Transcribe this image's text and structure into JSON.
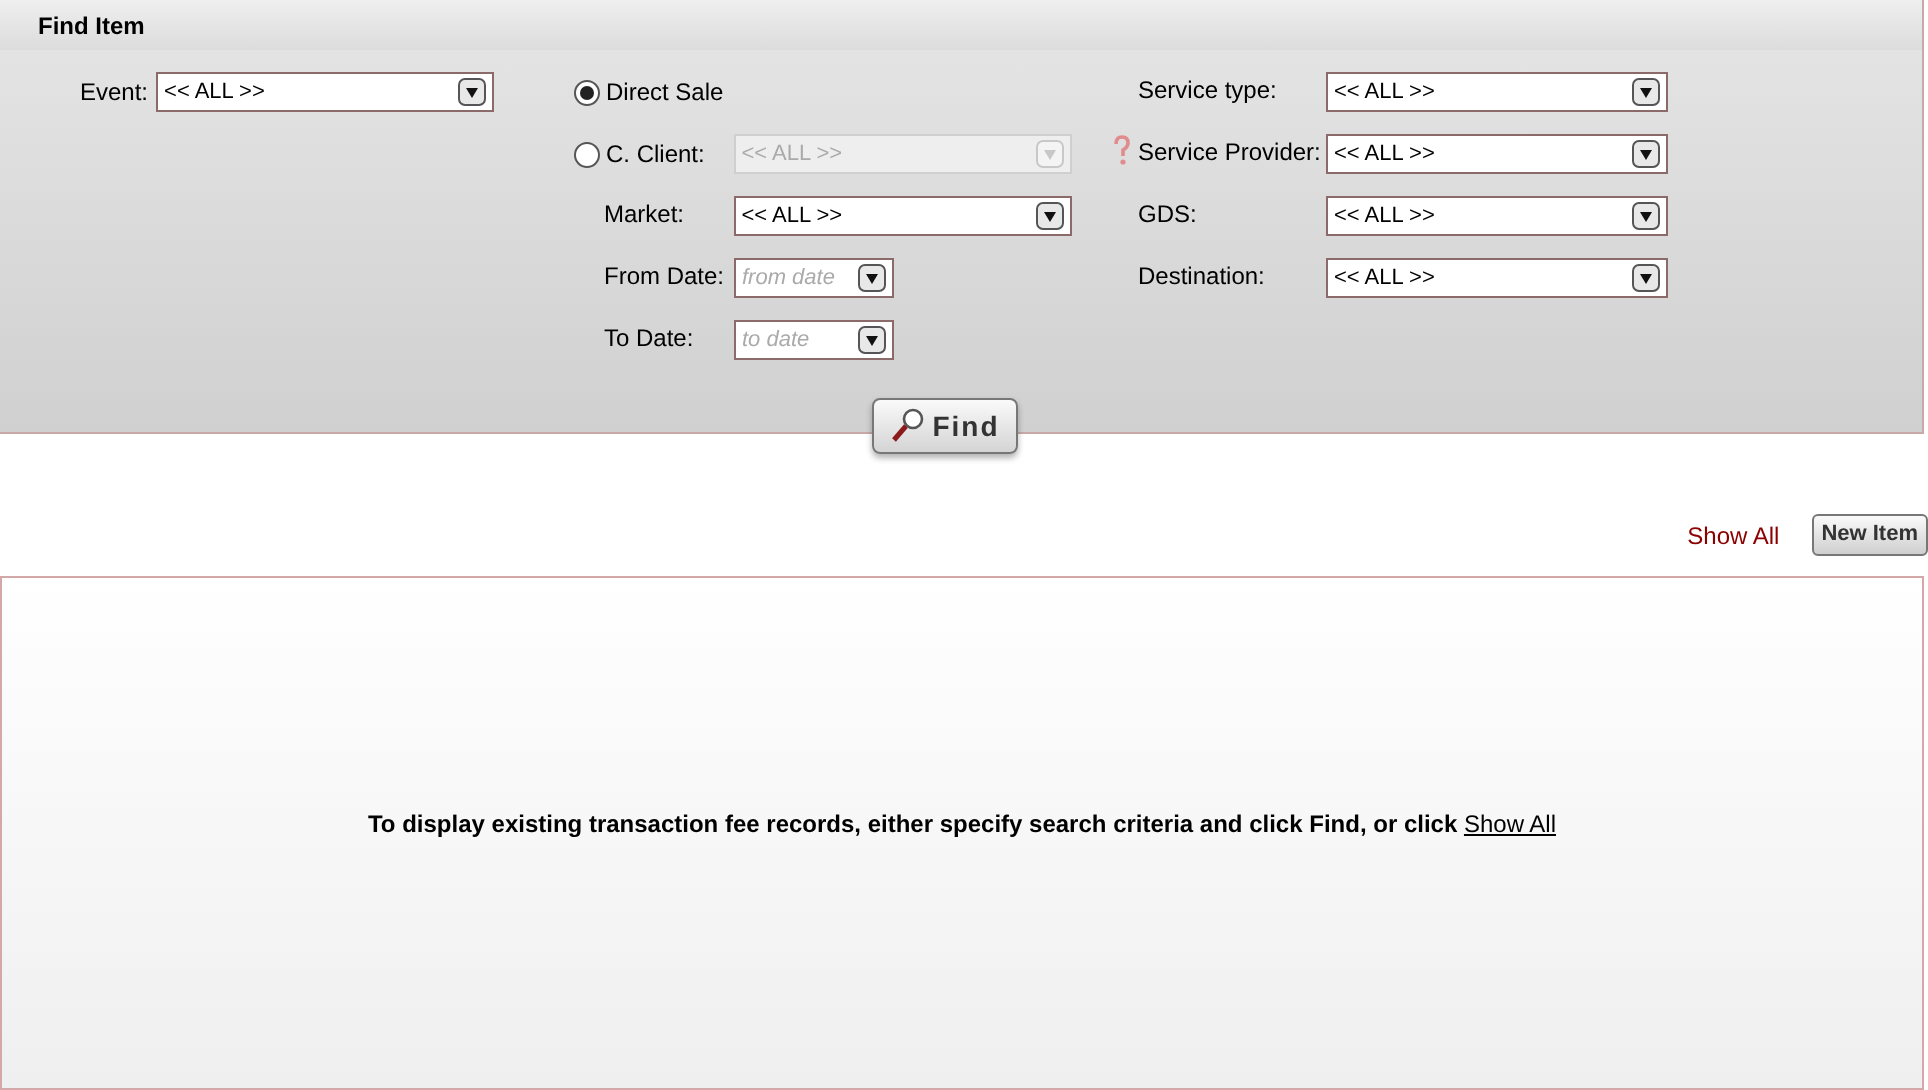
{
  "panel": {
    "title": "Find Item"
  },
  "event": {
    "label": "Event:",
    "value": "<< ALL >>"
  },
  "sale_type": [
    {
      "label": "Direct Sale",
      "selected": true
    },
    {
      "label": "C. Client:",
      "selected": false,
      "field": {
        "value": "<< ALL >>",
        "disabled": true
      }
    }
  ],
  "middle_fields": [
    {
      "label": "Market:",
      "kind": "select",
      "value": "<< ALL >>"
    },
    {
      "label": "From Date:",
      "kind": "date",
      "placeholder": "from date"
    },
    {
      "label": "To Date:",
      "kind": "date",
      "placeholder": "to date"
    }
  ],
  "right_fields": [
    {
      "label": "Service type:",
      "value": "<< ALL >>",
      "help": false
    },
    {
      "label": "Service Provider:",
      "value": "<< ALL >>",
      "help": true
    },
    {
      "label": "GDS:",
      "value": "<< ALL >>",
      "help": false
    },
    {
      "label": "Destination:",
      "value": "<< ALL >>",
      "help": false
    }
  ],
  "find_button": "Find",
  "show_all_link": "Show All",
  "new_item_button": "New Item",
  "results": {
    "message": "To display existing transaction fee records, either specify search criteria and click Find, or click ",
    "link": "Show All"
  }
}
